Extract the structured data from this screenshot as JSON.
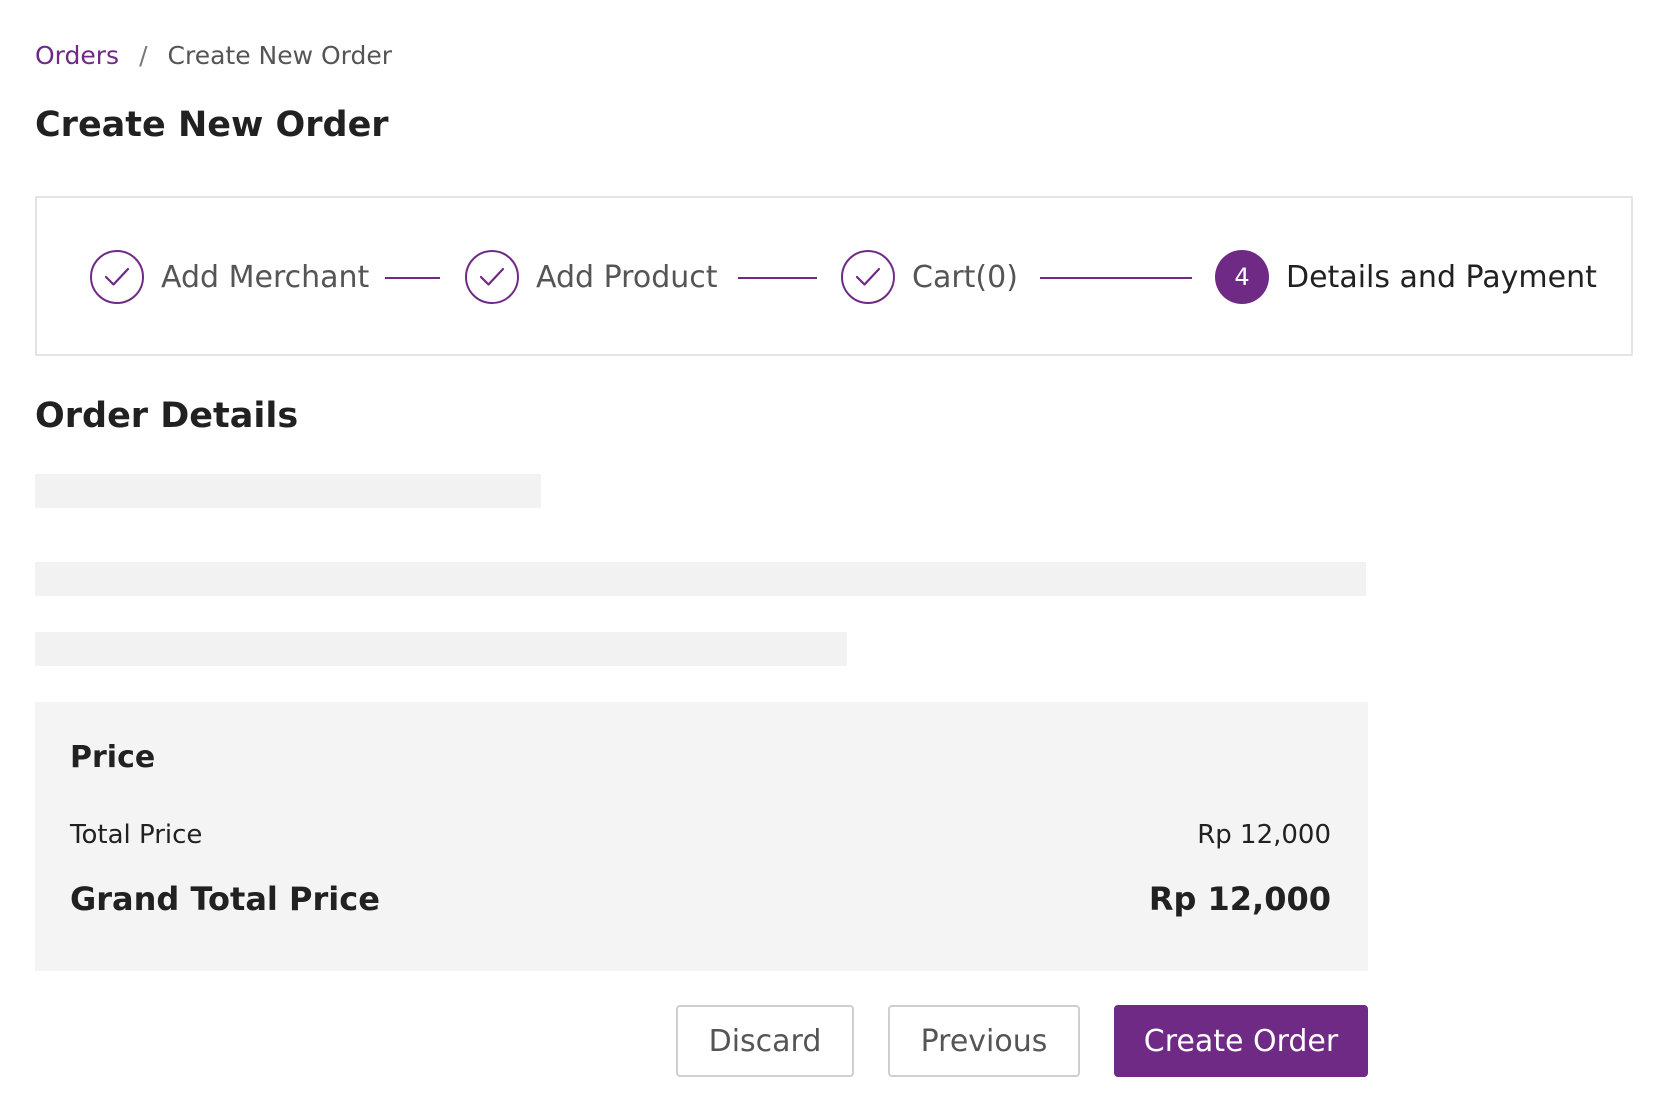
{
  "breadcrumb": {
    "parent": "Orders",
    "separator": "/",
    "current": "Create New Order"
  },
  "page_title": "Create New Order",
  "stepper": {
    "steps": [
      {
        "label": "Add Merchant",
        "state": "done",
        "icon": "check-icon"
      },
      {
        "label": "Add Product",
        "state": "done",
        "icon": "check-icon"
      },
      {
        "label": "Cart(0)",
        "state": "done",
        "icon": "check-icon"
      },
      {
        "label": "Details and Payment",
        "state": "active",
        "number": "4"
      }
    ]
  },
  "order_details": {
    "title": "Order Details",
    "loading": true
  },
  "price": {
    "heading": "Price",
    "total_label": "Total Price",
    "total_value": "Rp 12,000",
    "grand_label": "Grand Total Price",
    "grand_value": "Rp 12,000"
  },
  "actions": {
    "discard": "Discard",
    "previous": "Previous",
    "create": "Create Order"
  },
  "colors": {
    "accent": "#6e2a85",
    "panel_bg": "#f4f4f4",
    "skeleton": "#f2f2f2"
  }
}
